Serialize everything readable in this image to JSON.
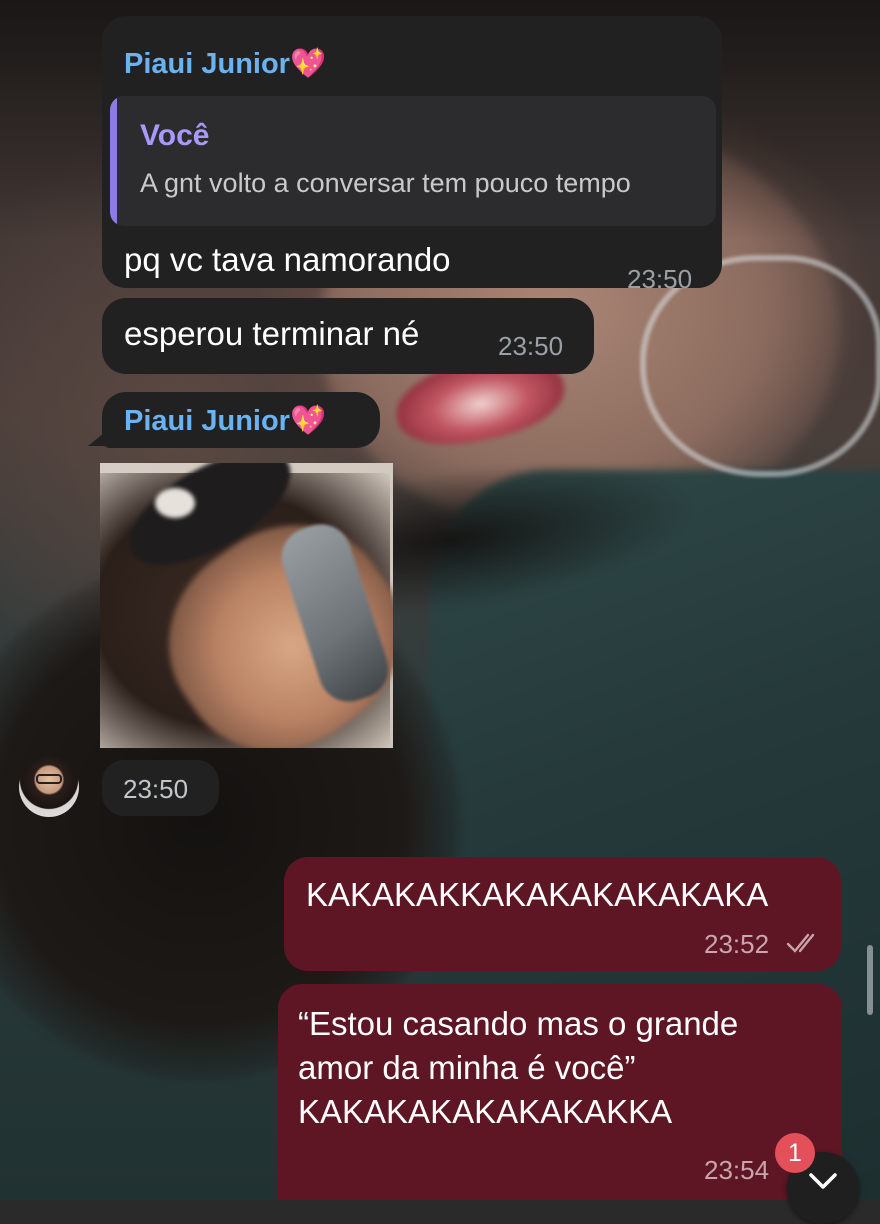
{
  "colors": {
    "incoming_bubble": "#212121",
    "outgoing_bubble": "#5e1624",
    "sender_name": "#6ab2f2",
    "reply_accent": "#a999ff",
    "badge": "#e4505a"
  },
  "messages": [
    {
      "direction": "incoming",
      "sender": "Piaui Junior💖",
      "reply": {
        "author": "Você",
        "text": "A gnt volto a conversar tem pouco tempo"
      },
      "text": "pq vc tava namorando",
      "time": "23:50"
    },
    {
      "direction": "incoming",
      "text": "esperou terminar né",
      "time": "23:50"
    },
    {
      "direction": "incoming",
      "sender": "Piaui Junior💖",
      "media": "photo",
      "time": "23:50"
    },
    {
      "direction": "outgoing",
      "text": "KAKAKAKKAKAKAKAKAKAKA",
      "time": "23:52",
      "status_icon": "double-check-icon"
    },
    {
      "direction": "outgoing",
      "text": "“Estou casando mas o grande\namor da minha é você”\nKAKAKAKAKAKAKAKKA",
      "time": "23:54"
    }
  ],
  "scroll_down": {
    "icon": "chevron-down-icon",
    "unread_count": "1"
  }
}
